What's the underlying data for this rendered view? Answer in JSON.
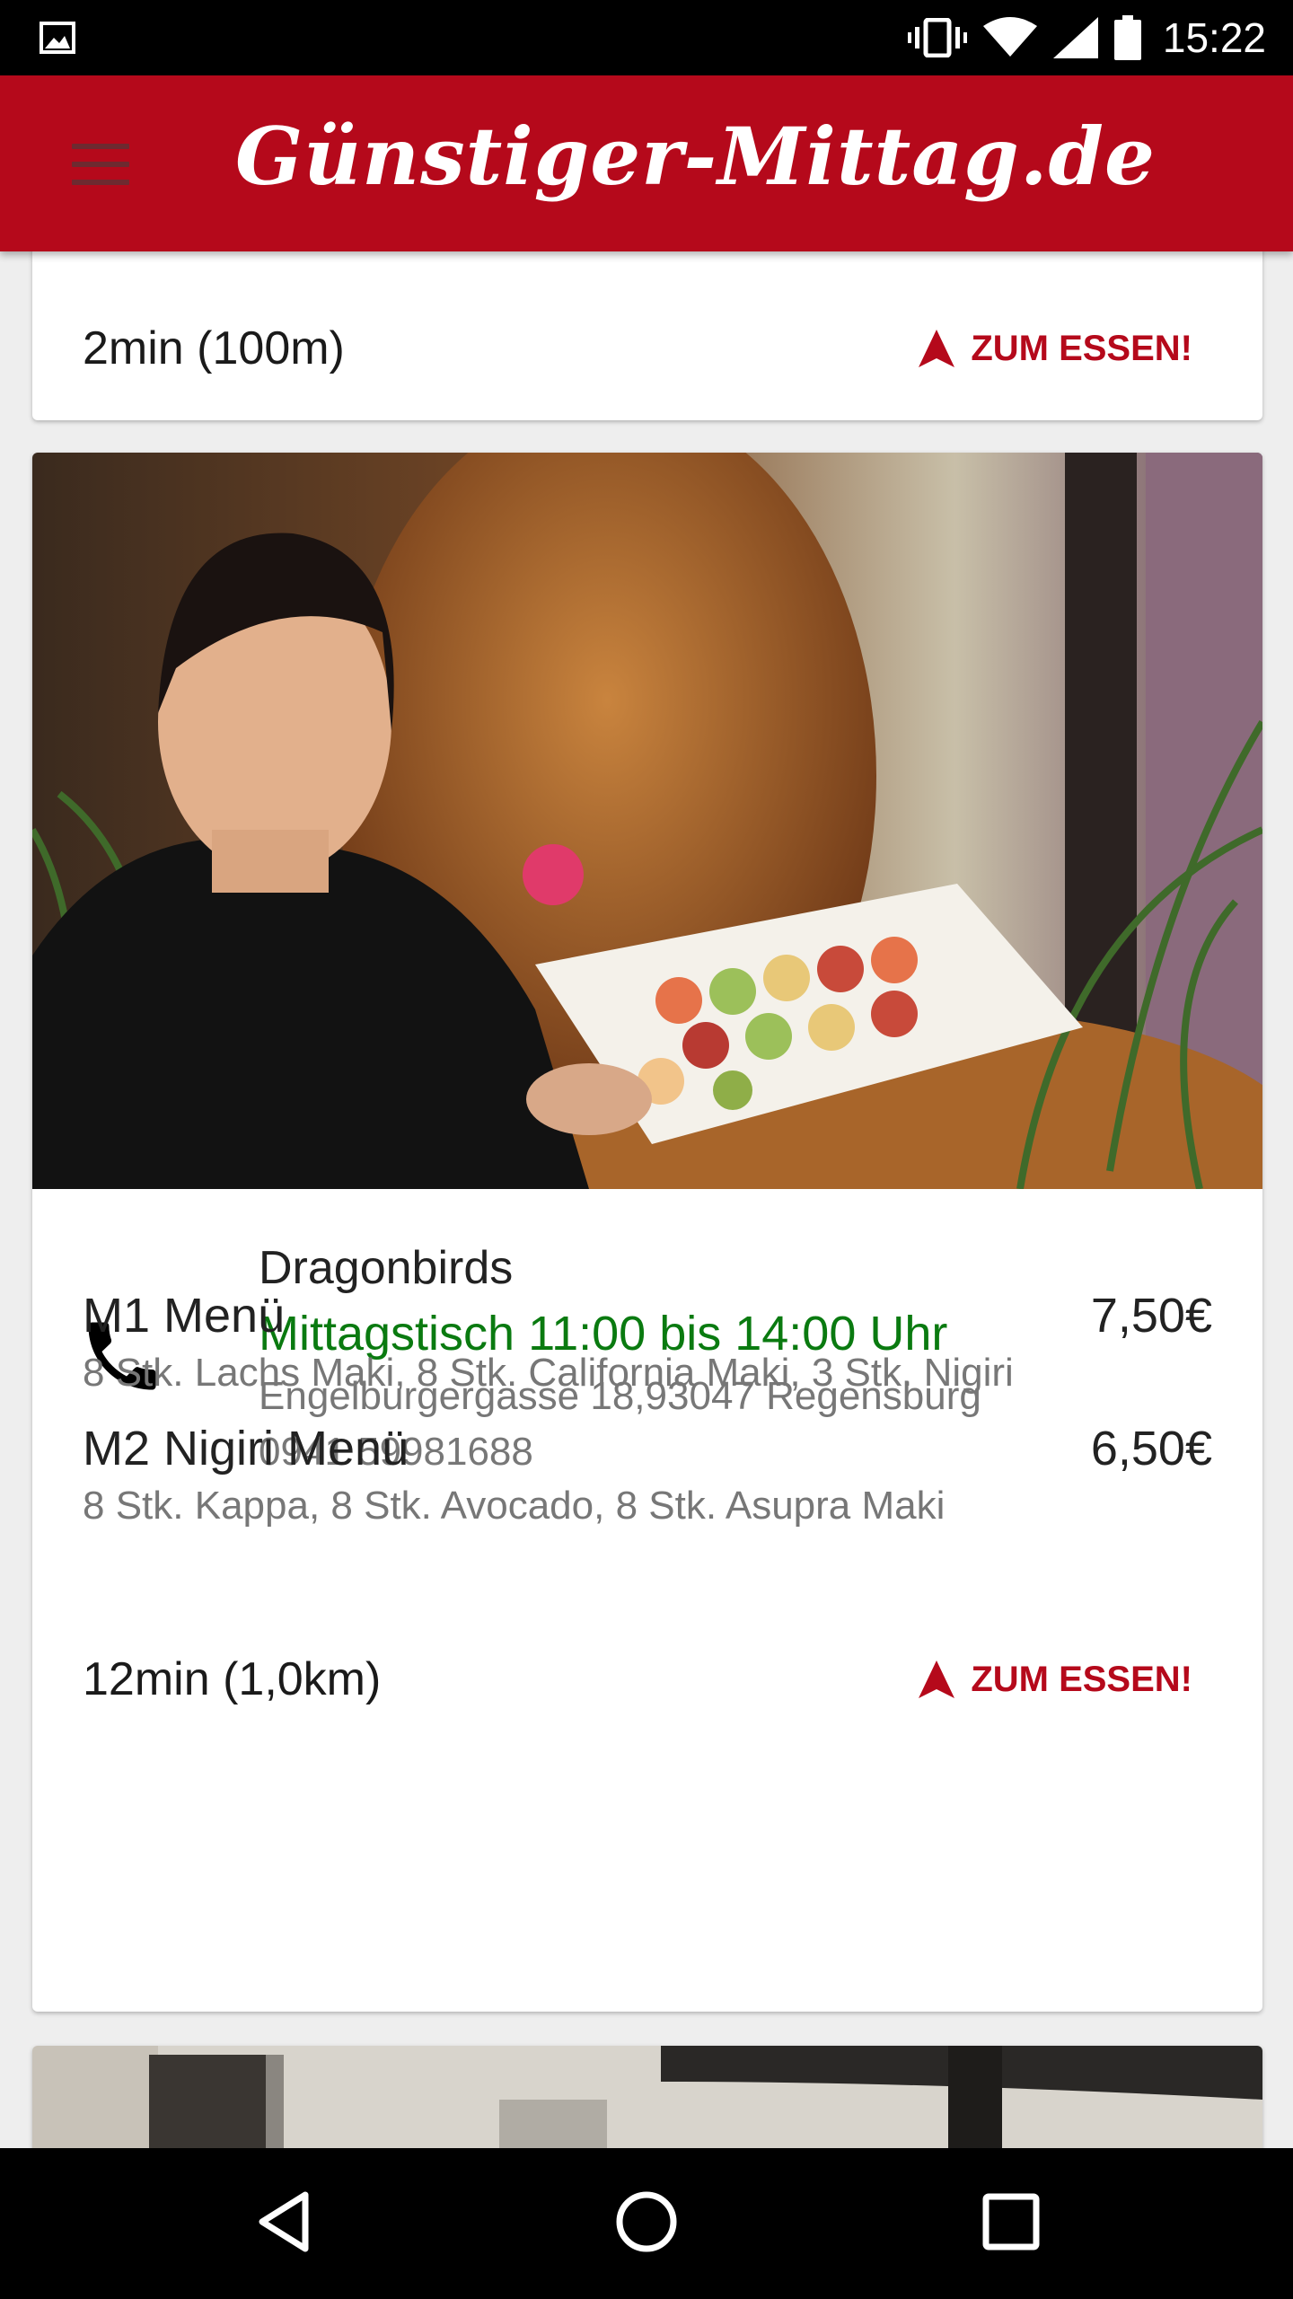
{
  "status_bar": {
    "time": "15:22",
    "icons": [
      "image-icon",
      "vibrate-icon",
      "wifi-icon",
      "signal-icon",
      "battery-icon"
    ]
  },
  "app_bar": {
    "title": "Günstiger-Mittag.de",
    "menu_icon": "hamburger-menu-icon",
    "background": "#b5091b"
  },
  "cards": {
    "previous": {
      "distance": "2min  (100m)",
      "action_label": "ZUM ESSEN!"
    },
    "current": {
      "image": "photo of a waitress holding a plate of sushi in front of a golden buddha statue",
      "restaurant_name": "Dragonbirds",
      "hours": "Mittagstisch 11:00 bis 14:00 Uhr",
      "address": "Engelburgergasse 18,93047 Regensburg",
      "phone": "0941 59981688",
      "menu_items": [
        {
          "name": "M1 Menü",
          "price": "7,50€",
          "description": "8 Stk. Lachs Maki, 8 Stk. California Maki, 3 Stk. Nigiri"
        },
        {
          "name": "M2 Nigiri Menü",
          "price": "6,50€",
          "description": "8 Stk. Kappa, 8 Stk. Avocado, 8 Stk. Asupra Maki"
        }
      ],
      "distance": "12min  (1,0km)",
      "action_label": "ZUM ESSEN!"
    }
  },
  "colors": {
    "accent": "#b5091b",
    "hours_green": "#0a7a10",
    "secondary_text": "#777777"
  },
  "nav_bar": {
    "icons": [
      "back-icon",
      "home-icon",
      "recents-icon"
    ]
  }
}
